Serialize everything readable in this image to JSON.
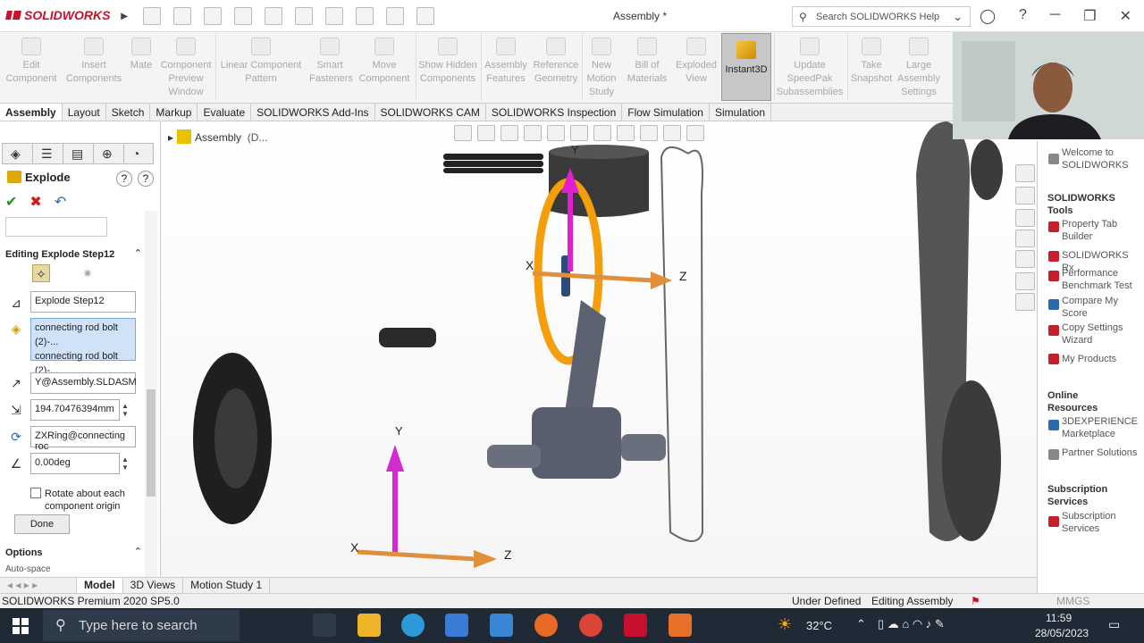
{
  "titlebar": {
    "logo_text": "SOLIDWORKS",
    "doc_title": "Assembly *",
    "search_placeholder": "Search SOLIDWORKS Help"
  },
  "commandbar": {
    "items": [
      {
        "label": "Edit Component"
      },
      {
        "label": "Insert Components"
      },
      {
        "label": "Mate"
      },
      {
        "label": "Component Preview Window"
      },
      {
        "label": "Linear Component Pattern"
      },
      {
        "label": "Smart Fasteners"
      },
      {
        "label": "Move Component"
      },
      {
        "label": "Show Hidden Components"
      },
      {
        "label": "Assembly Features"
      },
      {
        "label": "Reference Geometry"
      },
      {
        "label": "New Motion Study"
      },
      {
        "label": "Bill of Materials"
      },
      {
        "label": "Exploded View"
      },
      {
        "label": "Instant3D"
      },
      {
        "label": "Update SpeedPak Subassemblies"
      },
      {
        "label": "Take Snapshot"
      },
      {
        "label": "Large Assembly Settings"
      }
    ]
  },
  "tabs": [
    "Assembly",
    "Layout",
    "Sketch",
    "Markup",
    "Evaluate",
    "SOLIDWORKS Add-Ins",
    "SOLIDWORKS CAM",
    "SOLIDWORKS Inspection",
    "Flow Simulation",
    "Simulation"
  ],
  "property_manager": {
    "title": "Explode",
    "section_title": "Editing Explode Step12",
    "step_name": "Explode Step12",
    "components": [
      "connecting rod bolt (2)-...",
      "connecting rod bolt (2)-..."
    ],
    "direction": "Y@Assembly.SLDASM",
    "distance": "194.70476394mm",
    "rotation_axis": "ZXRing@connecting roc",
    "angle": "0.00deg",
    "rotate_checkbox_label": "Rotate about each component origin",
    "done_label": "Done",
    "options_title": "Options",
    "options_partial": "Auto-space"
  },
  "viewport": {
    "tree_label": "Assembly",
    "tree_suffix": "(D...",
    "triad_labels": {
      "x": "X",
      "y": "Y",
      "z": "Z"
    }
  },
  "task_pane": {
    "welcome": "Welcome to SOLIDWORKS",
    "tools_header": "SOLIDWORKS Tools",
    "tools": [
      "Property Tab Builder",
      "SOLIDWORKS Rx",
      "Performance Benchmark Test",
      "Compare My Score",
      "Copy Settings Wizard",
      "My Products"
    ],
    "online_header": "Online Resources",
    "online": [
      "3DEXPERIENCE Marketplace",
      "Partner Solutions"
    ],
    "subs_header": "Subscription Services",
    "subs": [
      "Subscription Services"
    ]
  },
  "bottom_tabs": [
    "Model",
    "3D Views",
    "Motion Study 1"
  ],
  "status": {
    "product": "SOLIDWORKS Premium 2020 SP5.0",
    "state": "Under Defined",
    "mode": "Editing Assembly",
    "units": "MMGS"
  },
  "taskbar": {
    "search_placeholder": "Type here to search",
    "temperature": "32°C",
    "time": "11:59",
    "date": "28/05/2023"
  },
  "colors": {
    "brand": "#c8102e",
    "selection": "#cfe2f8",
    "taskbar": "#1f2a36"
  }
}
